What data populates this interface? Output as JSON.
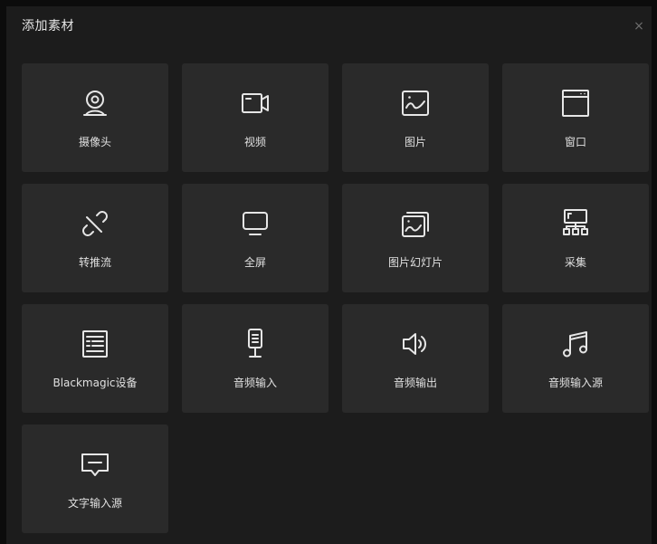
{
  "dialog": {
    "title": "添加素材",
    "close_label": "×"
  },
  "items": [
    {
      "label": "摄像头",
      "icon": "webcam-icon"
    },
    {
      "label": "视频",
      "icon": "video-camera-icon"
    },
    {
      "label": "图片",
      "icon": "image-icon"
    },
    {
      "label": "窗口",
      "icon": "window-icon"
    },
    {
      "label": "转推流",
      "icon": "link-broken-icon"
    },
    {
      "label": "全屏",
      "icon": "monitor-icon"
    },
    {
      "label": "图片幻灯片",
      "icon": "image-slideshow-icon"
    },
    {
      "label": "采集",
      "icon": "capture-network-icon"
    },
    {
      "label": "Blackmagic设备",
      "icon": "blackmagic-device-icon"
    },
    {
      "label": "音频输入",
      "icon": "microphone-icon"
    },
    {
      "label": "音频输出",
      "icon": "speaker-icon"
    },
    {
      "label": "音频输入源",
      "icon": "music-note-icon"
    },
    {
      "label": "文字输入源",
      "icon": "text-message-icon"
    }
  ],
  "colors": {
    "background": "#1c1c1c",
    "tile": "#2a2a2a",
    "text": "#e0e0e0",
    "icon": "#e6e6e6"
  }
}
